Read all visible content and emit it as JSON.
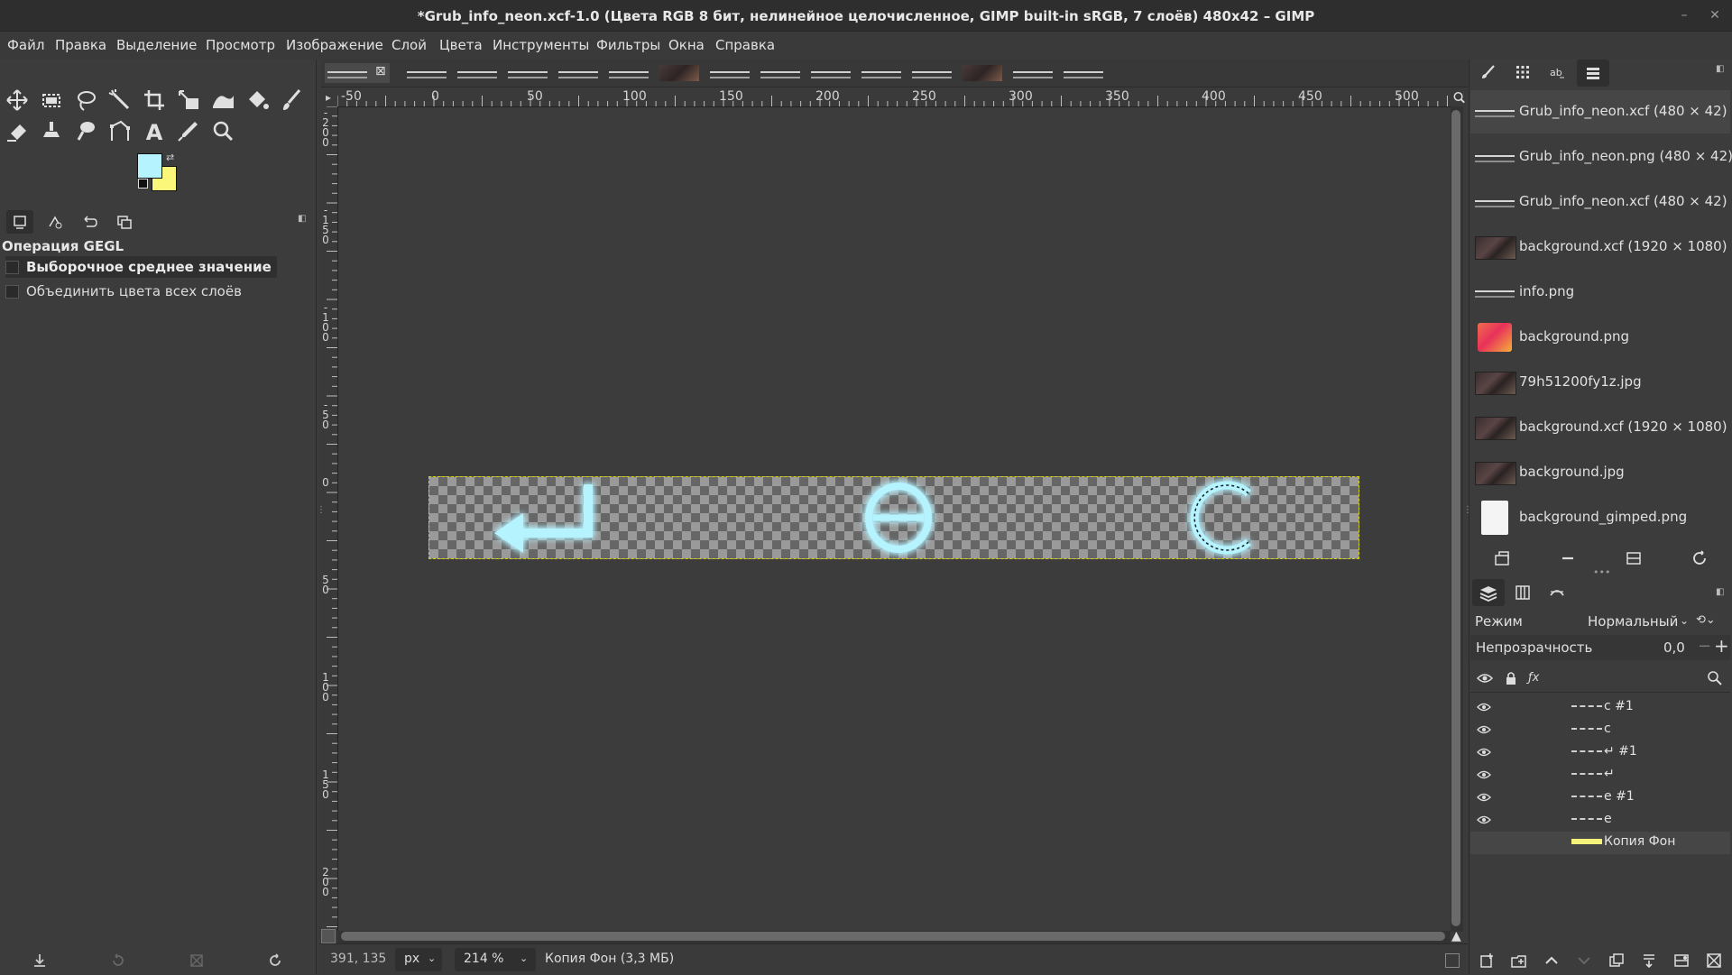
{
  "window": {
    "title": "*Grub_info_neon.xcf-1.0 (Цвета RGB 8 бит, нелинейное целочисленное, GIMP built-in sRGB, 7 слоёв) 480x42 – GIMP",
    "minimize": "–",
    "close": "✕"
  },
  "menubar": [
    "Файл",
    "Правка",
    "Выделение",
    "Просмотр",
    "Изображение",
    "Слой",
    "Цвета",
    "Инструменты",
    "Фильтры",
    "Окна",
    "Справка"
  ],
  "toolbox": {
    "tools_row1": [
      "move-tool",
      "rect-select-tool",
      "lasso-tool",
      "fuzzy-select-tool",
      "crop-tool",
      "scale-tool",
      "warp-tool",
      "bucket-fill-tool",
      "paintbrush-tool"
    ],
    "tools_row2": [
      "eraser-tool",
      "clone-tool",
      "smudge-tool",
      "paths-tool",
      "text-tool",
      "color-picker-tool",
      "zoom-tool"
    ],
    "foreground_color": "#b5f3ff",
    "background_color": "#fbf77a"
  },
  "tool_options": {
    "title": "Операция GEGL",
    "options": [
      {
        "label": "Выборочное среднее значение",
        "checked": false,
        "highlighted": true
      },
      {
        "label": "Объединить цвета всех слоёв",
        "checked": false,
        "highlighted": false
      }
    ]
  },
  "ruler": {
    "h_labels": [
      "-50",
      "0",
      "50",
      "100",
      "150",
      "200",
      "250",
      "300",
      "350",
      "400",
      "450",
      "500"
    ],
    "v_labels": [
      "-200",
      "-150",
      "-100",
      "-50",
      "0",
      "50",
      "100",
      "150",
      "200"
    ]
  },
  "canvas": {
    "glyphs": [
      "↵",
      "e",
      "c"
    ],
    "neon_color": "#b5f3ff"
  },
  "statusbar": {
    "pointer": "391, 135",
    "unit": "px",
    "zoom": "214 %",
    "message": "Копия Фон (3,3 МБ)"
  },
  "images_panel": {
    "items": [
      {
        "label": "Grub_info_neon.xcf (480 × 42)",
        "thumb": "strip",
        "selected": true
      },
      {
        "label": "Grub_info_neon.png (480 × 42)",
        "thumb": "strip",
        "selected": false
      },
      {
        "label": "Grub_info_neon.xcf (480 × 42)",
        "thumb": "strip",
        "selected": false
      },
      {
        "label": "background.xcf (1920 × 1080)",
        "thumb": "photo",
        "selected": false
      },
      {
        "label": "info.png",
        "thumb": "strip",
        "selected": false
      },
      {
        "label": "background.png",
        "thumb": "gradient",
        "selected": false
      },
      {
        "label": "79h51200fy1z.jpg",
        "thumb": "photo",
        "selected": false
      },
      {
        "label": "background.xcf (1920 × 1080)",
        "thumb": "photo",
        "selected": false
      },
      {
        "label": "background.jpg",
        "thumb": "photo",
        "selected": false
      },
      {
        "label": "background_gimped.png",
        "thumb": "doc",
        "selected": false
      }
    ]
  },
  "layers_panel": {
    "mode_label": "Режим",
    "mode_value": "Нормальный",
    "opacity_label": "Непрозрачность",
    "opacity_value": "0,0",
    "layers": [
      {
        "name": "c #1",
        "visible": true,
        "selected": false,
        "thumb": "strip"
      },
      {
        "name": "c",
        "visible": true,
        "selected": false,
        "thumb": "strip"
      },
      {
        "name": "↵ #1",
        "visible": true,
        "selected": false,
        "thumb": "strip"
      },
      {
        "name": "↵",
        "visible": true,
        "selected": false,
        "thumb": "strip"
      },
      {
        "name": "e #1",
        "visible": true,
        "selected": false,
        "thumb": "strip"
      },
      {
        "name": "e",
        "visible": true,
        "selected": false,
        "thumb": "strip"
      },
      {
        "name": "Копия Фон",
        "visible": false,
        "selected": true,
        "thumb": "yellow"
      }
    ]
  }
}
